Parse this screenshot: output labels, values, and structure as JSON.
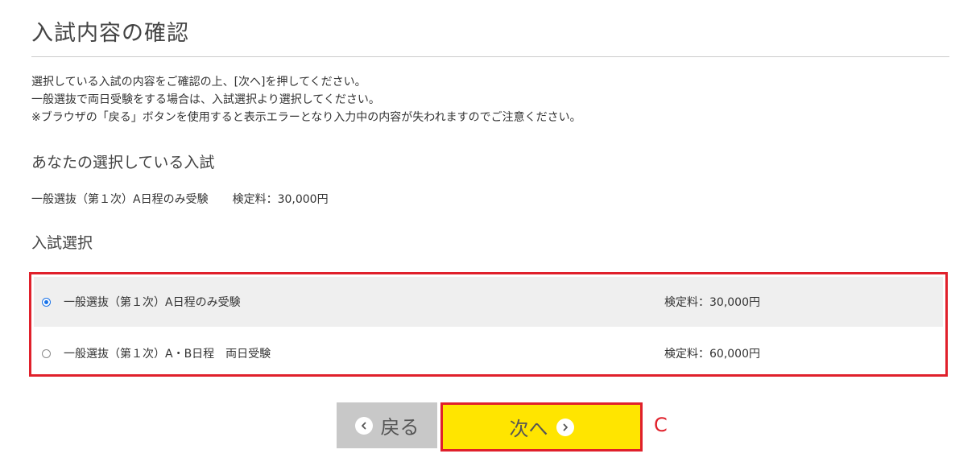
{
  "page": {
    "title": "入試内容の確認"
  },
  "intro": {
    "line1": "選択している入試の内容をご確認の上、[次へ]を押してください。",
    "line2": "一般選抜で両日受験をする場合は、入試選択より選択してください。",
    "line3": "※ブラウザの「戻る」ボタンを使用すると表示エラーとなり入力中の内容が失われますのでご注意ください。"
  },
  "current_selection": {
    "heading": "あなたの選択している入試",
    "name": "一般選抜（第１次）A日程のみ受験",
    "fee": "検定料：30,000円"
  },
  "exam_selection": {
    "heading": "入試選択",
    "options": [
      {
        "label": "一般選抜（第１次）A日程のみ受験",
        "fee": "検定料：30,000円",
        "selected": true
      },
      {
        "label": "一般選抜（第１次）A・B日程　両日受験",
        "fee": "検定料：60,000円",
        "selected": false
      }
    ]
  },
  "buttons": {
    "back_label": "戻る",
    "next_label": "次へ",
    "back_icon": "chevron-left-circle-icon",
    "next_icon": "chevron-right-circle-icon"
  },
  "annotation": {
    "label": "C"
  },
  "colors": {
    "highlight_border": "#e0202b",
    "next_button_bg": "#ffe500",
    "back_button_bg": "#c8c8c8",
    "selected_row_bg": "#efefef",
    "radio_checked": "#1a73e8"
  }
}
